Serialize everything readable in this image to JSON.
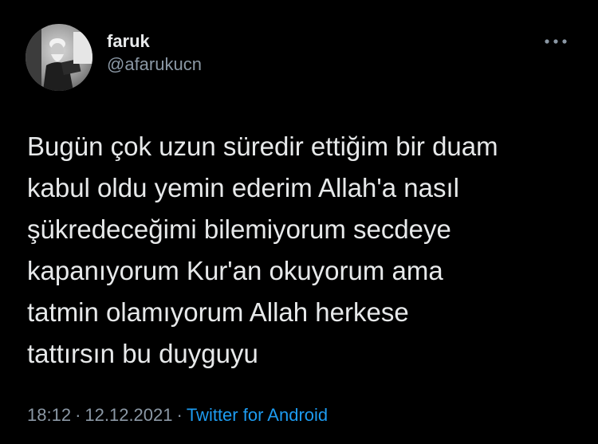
{
  "user": {
    "display_name": "faruk",
    "handle": "@afarukucn",
    "avatar_icon": "avatar-photo"
  },
  "actions": {
    "more_icon": "more-horizontal-icon"
  },
  "tweet": {
    "text": "Bugün çok uzun süredir ettiğim bir duam\nkabul oldu yemin ederim Allah'a nasıl\nşükredeceğimi bilemiyorum secdeye\nkapanıyorum Kur'an okuyorum ama\ntatmin olamıyorum Allah herkese\ntattırsın bu duyguyu"
  },
  "meta": {
    "time": "18:12",
    "separator": "·",
    "date": "12.12.2021",
    "source": "Twitter for Android"
  },
  "colors": {
    "background": "#000000",
    "text": "#e7e9ea",
    "secondary": "#8b98a5",
    "link": "#1d9bf0"
  }
}
